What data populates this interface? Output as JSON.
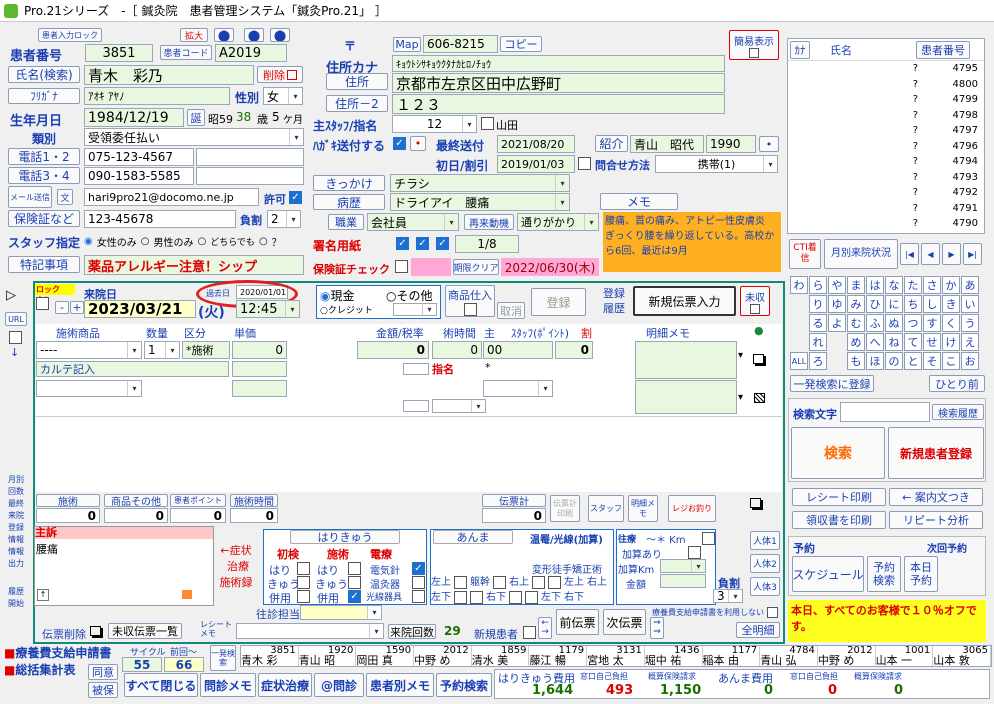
{
  "window": {
    "title": "Pro.21シリーズ　-［ 鍼灸院　患者管理システム「鍼灸Pro.21」 ］"
  },
  "top": {
    "lock_btn": "患者入力ロック",
    "zoom_btn": "拡大",
    "simple_view": "簡易表示",
    "map": "Map",
    "copy": "コピー",
    "postal_mark": "〒",
    "postal": "606-8215"
  },
  "patient": {
    "id_label": "患者番号",
    "id": "3851",
    "code_label": "患者コード",
    "code": "A2019",
    "name_btn": "氏名(検索)",
    "name": "青木　彩乃",
    "delete": "削除",
    "furigana_label": "ﾌﾘｶﾞﾅ",
    "furigana": "ｱｵｷ ｱﾔﾉ",
    "sex_label": "性別",
    "sex": "女",
    "birth_label": "生年月日",
    "birth": "1984/12/19",
    "birth_mark": "誕",
    "era": "昭59",
    "age": "38",
    "age_unit": "歳",
    "months": "5",
    "month_unit": "ケ月",
    "type_label": "類別",
    "type": "受領委任払い",
    "tel12_btn": "電話1・2",
    "tel1": "075-123-4567",
    "tel34_btn": "電話3・4",
    "tel3": "090-1583-5585",
    "mail_btn": "メール送信",
    "mail_icon": "文",
    "email": "hari9pro21@docomo.ne.jp",
    "permit": "許可",
    "insurance_btn": "保険証など",
    "insurance": "123-45678",
    "burden_label": "負割",
    "burden": "2",
    "staff_label": "スタッフ指定",
    "staff_opt1": "女性のみ",
    "staff_opt2": "男性のみ",
    "staff_opt3": "どちらでも",
    "staff_opt4": "？",
    "note_btn": "特記事項",
    "note": "薬品アレルギー注意！シップ"
  },
  "address": {
    "kana_label": "住所カナ",
    "kana": "ｷｮｳﾄｼｻｷｮｳｸﾀﾅｶﾋﾛﾉﾁｮｳ",
    "addr_btn": "住所",
    "addr": "京都市左京区田中広野町",
    "addr2_btn": "住所－2",
    "addr2": "１２３",
    "main_staff_label": "主ｽﾀｯﾌ/指名",
    "main_staff": "12",
    "yamada": "山田",
    "postcard_label": "ﾊｶﾞｷ送付する",
    "last_sent_label": "最終送付",
    "last_sent": "2021/08/20",
    "intro_btn": "紹介",
    "intro_name": "青山　昭代",
    "intro_id": "1990",
    "intro_dot": "•",
    "first_label": "初日/割引",
    "first": "2019/01/03",
    "contact_label": "問合せ方法",
    "contact": "携帯(1)",
    "trigger_btn": "きっかけ",
    "trigger": "チラシ",
    "disease_btn": "病歴",
    "disease": "ドライアイ　腰痛",
    "memo_btn": "メモ",
    "job_btn": "職業",
    "job": "会社員",
    "recall_btn": "再来動機",
    "recall": "通りがかり",
    "sign_label": "署名用紙",
    "sign_count": "1/8",
    "ins_check_label": "保険証チェック",
    "ins_check_btn": "期限クリア",
    "ins_date": "2022/06/30(木)",
    "memo_text": "腰痛、首の痛み、アトピー性皮膚炎　ぎっくり腰を繰り返している。高校から6回、最近は9月"
  },
  "list": {
    "kana_col": "ｶﾅ",
    "name_col": "氏名",
    "id_col": "患者番号",
    "rows": [
      {
        "m": "?",
        "id": "4795"
      },
      {
        "m": "?",
        "id": "4800"
      },
      {
        "m": "?",
        "id": "4799"
      },
      {
        "m": "?",
        "id": "4798"
      },
      {
        "m": "?",
        "id": "4797"
      },
      {
        "m": "?",
        "id": "4796"
      },
      {
        "m": "?",
        "id": "4794"
      },
      {
        "m": "?",
        "id": "4793"
      },
      {
        "m": "?",
        "id": "4792"
      },
      {
        "m": "?",
        "id": "4791"
      },
      {
        "m": "?",
        "id": "4790"
      }
    ],
    "cti": "CTI着信",
    "monthly": "月別来院状況",
    "nav": [
      "|◀",
      "◀",
      "▶",
      "▶|"
    ]
  },
  "kana_pad": {
    "rows": [
      [
        "わ",
        "ら",
        "や",
        "ま",
        "は",
        "な",
        "た",
        "さ",
        "か",
        "あ"
      ],
      [
        "",
        "り",
        "ゆ",
        "み",
        "ひ",
        "に",
        "ち",
        "し",
        "き",
        "い"
      ],
      [
        "",
        "る",
        "よ",
        "む",
        "ふ",
        "ぬ",
        "つ",
        "す",
        "く",
        "う"
      ],
      [
        "",
        "れ",
        "",
        "め",
        "へ",
        "ね",
        "て",
        "せ",
        "け",
        "え"
      ],
      [
        "ALL",
        "ろ",
        "",
        "も",
        "ほ",
        "の",
        "と",
        "そ",
        "こ",
        "お"
      ]
    ],
    "one_search": "一発検索に登録",
    "one_person": "ひとり前",
    "search_word": "検索文字",
    "search_history": "検索履歴",
    "search": "検索",
    "new_patient": "新規患者登録",
    "receipt_print": "レシート印刷",
    "guide_text": "← 案内文つき",
    "receipt_form": "領収書を印刷",
    "repeat": "リピート分析",
    "reserve": "予約",
    "next_reserve": "次回予約",
    "schedule": "スケジュール",
    "reserve_search": "予約検索",
    "today_reserve": "本日予約",
    "notice": "本日、すべてのお客様で１０％オフです。"
  },
  "visit": {
    "lock": "ロック中！",
    "visit_label": "来院日",
    "prev_label": "過去日",
    "prev_date": "2020/01/01",
    "date": "2023/03/21",
    "dow": "(火)",
    "time": "12:45",
    "cash": "現金",
    "other": "その他",
    "credit": "クレジット",
    "goods": "商品仕入",
    "cancel": "取消",
    "register": "登録",
    "reg_hist": "登録履歴",
    "new_slip": "新規伝票入力",
    "unpaid": "未収",
    "cols": [
      "施術商品",
      "数量",
      "区分",
      "単価",
      "金額/税率",
      "術時間",
      "主",
      "ｽﾀｯﾌ(ﾎﾟｲﾝﾄ)",
      "割",
      "明細メモ"
    ],
    "row1": {
      "item": "----",
      "qty": "1",
      "kind": "*施術",
      "price": "0",
      "amount": "0",
      "time": "0",
      "staff": "00",
      "disc": "0"
    },
    "row2": {
      "item": "カルテ記入",
      "shimei": "指名",
      "star": "*"
    },
    "side": [
      "URL",
      "月別",
      "回数",
      "最終",
      "来院",
      "登録",
      "情報",
      "情報",
      "出力",
      "履歴",
      "開始"
    ],
    "sum_labels": {
      "treat": "施術",
      "goods": "商品その他",
      "points": "患者ポイント",
      "treat_time": "施術時間",
      "slip": "伝票計",
      "slip_print": "伝票計印刷",
      "staff": "スタッフ",
      "detail_memo": "明細メモ",
      "regi": "レジお釣り"
    },
    "sums": {
      "treat": "0",
      "goods": "0",
      "points": "0",
      "treat_time": "0",
      "slip": "0"
    }
  },
  "chart": {
    "main_label": "主訴",
    "main": "腰痛",
    "symptom": "←症状",
    "cure": "治療",
    "record": "施術録",
    "hari": "はりきゅう",
    "anma": "あんま",
    "onkan": "温罨/光線(加算)",
    "first": "初検",
    "treat": "施術",
    "elec": "電療",
    "hari_c": "はり",
    "kyu_c": "きゅう",
    "hei": "併用",
    "elec1": "電気針",
    "elec2": "温灸器",
    "elec3": "光線器具",
    "ochin": "往療",
    "km": "～＊ Km",
    "kasan": "加算あり",
    "kasan_km": "加算Km",
    "kingaku": "金額",
    "trunk": "躯幹",
    "left_up": "左上",
    "right_up": "右上",
    "left_down": "左下",
    "right_down": "右下",
    "henkei": "変形徒手矯正術",
    "fukuwari": "負割",
    "fukuwari_val": "3",
    "persons": [
      "人体1",
      "人体2",
      "人体3"
    ],
    "staff_label": "往診担当",
    "receipt_memo": "レシートメモ",
    "visit_count_btn": "来院回数",
    "visit_count": "29",
    "new_patient": "新規患者",
    "prev_slip": "前伝票",
    "next_slip": "次伝票",
    "ins_msg": "療養費支給申請書を利用しない",
    "all_detail": "全明細",
    "slip_delete": "伝票削除",
    "unpaid_list": "未収伝票一覧"
  },
  "bottom": {
    "app1": "療養費支給申請書",
    "app2": "総括集計表",
    "cycle": "サイクル",
    "prev": "前回～",
    "cycle_val": "55",
    "prev_val": "66",
    "ippatsu": "一発検索",
    "doi": "同意",
    "hihou": "被保",
    "close": "すべて閉じる",
    "monshin_memo": "問診メモ",
    "symptom": "症状治療",
    "monshin": "@問診",
    "patient_memo": "患者別メモ",
    "reserve_search": "予約検索",
    "strip_ids": [
      "3851",
      "1920",
      "1590",
      "2012",
      "1859",
      "1179",
      "3131",
      "1436",
      "1177",
      "4784",
      "2012",
      "1001",
      "3065"
    ],
    "strip_names": [
      "青木 彩",
      "青山 昭",
      "岡田 真",
      "中野 め",
      "清水 美",
      "藤江 暢",
      "宮地 太",
      "堀中 祐",
      "稲本 由",
      "青山 弘",
      "中野 め",
      "山本 一",
      "山本 敦"
    ],
    "hari_label": "はりきゅう費用",
    "hari_val": "1,644",
    "self_label": "窓口自己負担",
    "self_val": "493",
    "ins_label": "概算保険請求",
    "ins_val": "1,150",
    "anma_label": "あんま費用",
    "anma_val": "0",
    "self2_label": "窓口自己負担",
    "self2_val": "0",
    "ins2_label": "概算保険請求",
    "ins2_val": "0"
  },
  "colors": {
    "teal": "#128a7a",
    "label": "#1a3fb3",
    "red": "#d00000",
    "orange_memo": "#ffb020",
    "notice_bg": "#ffff20"
  }
}
